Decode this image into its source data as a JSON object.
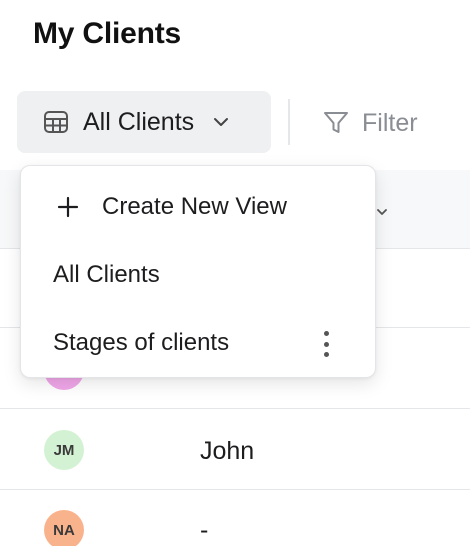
{
  "page": {
    "title": "My Clients"
  },
  "toolbar": {
    "view_label": "All Clients",
    "filter_label": "Filter"
  },
  "dropdown": {
    "create_label": "Create New View",
    "views": [
      {
        "label": "All Clients"
      },
      {
        "label": "Stages of clients"
      }
    ]
  },
  "rows": [
    {
      "initials": "",
      "name": "",
      "avatar_color": "#f0a6e8"
    },
    {
      "initials": "JM",
      "name": "John",
      "avatar_color": "#d3f1d3"
    },
    {
      "initials": "NA",
      "name": "-",
      "avatar_color": "#f9b38c"
    }
  ],
  "icons": {
    "view": "table-grid-icon",
    "view_toggle": "chevron-down-icon",
    "filter": "funnel-icon",
    "create": "plus-icon",
    "view_options": "kebab-menu-icon",
    "sort": "chevron-down-icon"
  },
  "colors": {
    "switcher_bg": "#eef0f2",
    "muted_text": "#8a8d93",
    "text": "#1d1d1f"
  }
}
